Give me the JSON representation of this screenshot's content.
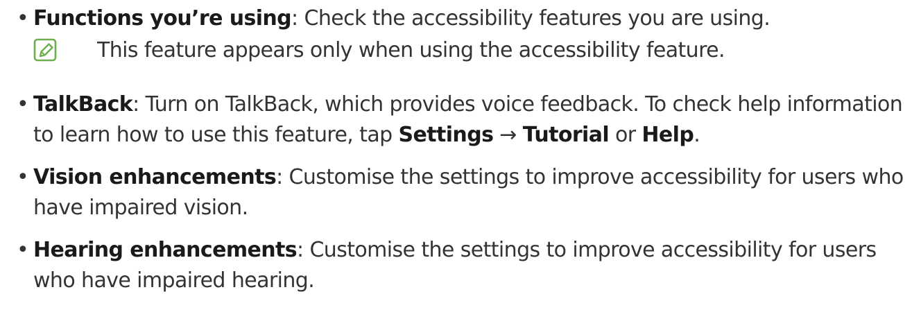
{
  "bullet_glyph": "•",
  "arrow_glyph": "→",
  "accent_color": "#6ab04c",
  "items": {
    "functions": {
      "term": "Functions you’re using",
      "text": ": Check the accessibility features you are using."
    },
    "note": {
      "icon": "note-pencil-icon",
      "text": "This feature appears only when using the accessibility feature."
    },
    "talkback": {
      "term": "TalkBack",
      "text_1": ": Turn on TalkBack, which provides voice feedback. To check help information to learn how to use this feature, tap ",
      "settings": "Settings",
      "tutorial": "Tutorial",
      "or": " or ",
      "help": "Help",
      "end": "."
    },
    "vision": {
      "term": "Vision enhancements",
      "text": ": Customise the settings to improve accessibility for users who have impaired vision."
    },
    "hearing": {
      "term": "Hearing enhancements",
      "text": ": Customise the settings to improve accessibility for users who have impaired hearing."
    }
  }
}
